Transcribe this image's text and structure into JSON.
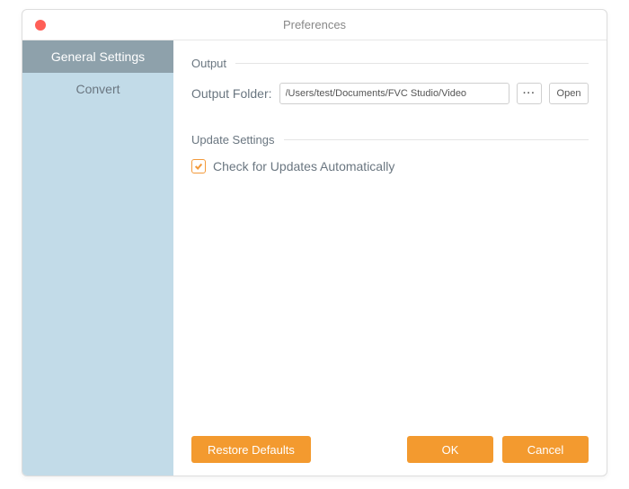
{
  "window": {
    "title": "Preferences"
  },
  "sidebar": {
    "items": [
      {
        "label": "General Settings",
        "active": true
      },
      {
        "label": "Convert",
        "active": false
      }
    ]
  },
  "sections": {
    "output": {
      "heading": "Output",
      "folder_label": "Output Folder:",
      "folder_value": "/Users/test/Documents/FVC Studio/Video",
      "ellipsis": "···",
      "open_label": "Open"
    },
    "update": {
      "heading": "Update Settings",
      "checkbox_label": "Check for Updates Automatically",
      "checked": true
    }
  },
  "footer": {
    "restore_label": "Restore Defaults",
    "ok_label": "OK",
    "cancel_label": "Cancel"
  },
  "colors": {
    "accent": "#f39a2f",
    "sidebar_bg": "#c2dbe8",
    "sidebar_active": "#8ea1ab",
    "text_muted": "#6a7680"
  }
}
